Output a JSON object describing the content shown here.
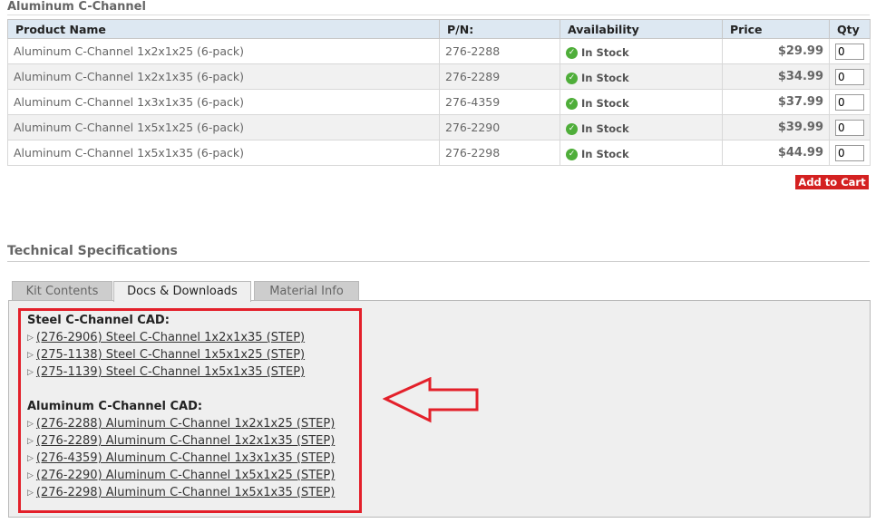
{
  "section_title": "Aluminum C-Channel",
  "table": {
    "headers": {
      "name": "Product Name",
      "pn": "P/N:",
      "availability": "Availability",
      "price": "Price",
      "qty": "Qty"
    },
    "rows": [
      {
        "name": "Aluminum C-Channel 1x2x1x25 (6-pack)",
        "pn": "276-2288",
        "availability": "In Stock",
        "price": "$29.99",
        "qty": "0"
      },
      {
        "name": "Aluminum C-Channel 1x2x1x35 (6-pack)",
        "pn": "276-2289",
        "availability": "In Stock",
        "price": "$34.99",
        "qty": "0"
      },
      {
        "name": "Aluminum C-Channel 1x3x1x35 (6-pack)",
        "pn": "276-4359",
        "availability": "In Stock",
        "price": "$37.99",
        "qty": "0"
      },
      {
        "name": "Aluminum C-Channel 1x5x1x25 (6-pack)",
        "pn": "276-2290",
        "availability": "In Stock",
        "price": "$39.99",
        "qty": "0"
      },
      {
        "name": "Aluminum C-Channel 1x5x1x35 (6-pack)",
        "pn": "276-2298",
        "availability": "In Stock",
        "price": "$44.99",
        "qty": "0"
      }
    ]
  },
  "add_to_cart_label": "Add to Cart",
  "tech_specs_title": "Technical Specifications",
  "tabs": [
    {
      "label": "Kit Contents",
      "active": false
    },
    {
      "label": "Docs & Downloads",
      "active": true
    },
    {
      "label": "Material Info",
      "active": false
    }
  ],
  "downloads": {
    "steel_heading": "Steel C-Channel CAD:",
    "steel": [
      "(276-2906) Steel C-Channel 1x2x1x35 (STEP)",
      "(275-1138) Steel C-Channel 1x5x1x25 (STEP)",
      "(275-1139) Steel C-Channel 1x5x1x35 (STEP)"
    ],
    "aluminum_heading": "Aluminum C-Channel CAD:",
    "aluminum": [
      "(276-2288) Aluminum C-Channel 1x2x1x25 (STEP)",
      "(276-2289) Aluminum C-Channel 1x2x1x35 (STEP)",
      "(276-4359) Aluminum C-Channel 1x3x1x35 (STEP)",
      "(276-2290) Aluminum C-Channel 1x5x1x25 (STEP)",
      "(276-2298) Aluminum C-Channel 1x5x1x35 (STEP)"
    ]
  },
  "colors": {
    "price_red": "#d01313",
    "header_blue": "#dde8f2",
    "in_stock_green": "#4fae3a",
    "annotation_red": "#e3202a",
    "add_to_cart_bg": "#d42121"
  },
  "icons": {
    "stock": "check-circle-icon",
    "download_bullet": "triangle-right-icon",
    "annotation": "arrow-left-icon"
  }
}
